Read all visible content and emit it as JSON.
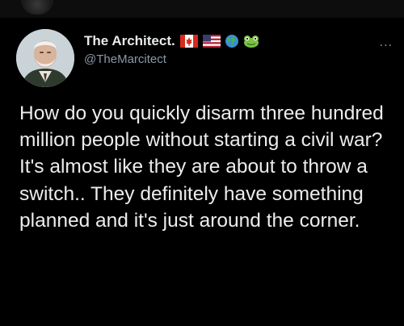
{
  "tweet": {
    "display_name": "The Architect.",
    "handle": "@TheMarcitect",
    "name_emojis": [
      "canada-flag-icon",
      "us-flag-icon",
      "globe-icon",
      "frog-icon"
    ],
    "more_label": "...",
    "text": "How do you quickly disarm three hundred million people without starting a civil war? It's almost like they are about to throw a switch.. They definitely have something planned and it's just around the corner."
  },
  "colors": {
    "background": "#000000",
    "text": "#e7e9ea",
    "secondary": "#8b98a5"
  }
}
